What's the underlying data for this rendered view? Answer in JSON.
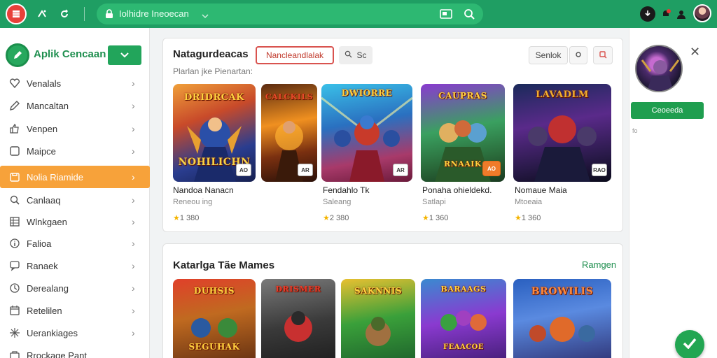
{
  "browser": {
    "url": "Iolhidre Ineoecan"
  },
  "sidebar": {
    "brand": "Aplik Cencaan",
    "items": [
      {
        "label": "Venalals",
        "icon": "heart-icon"
      },
      {
        "label": "Mancaltan",
        "icon": "edit-icon"
      },
      {
        "label": "Venpen",
        "icon": "thumbs-up-icon"
      },
      {
        "label": "Maipce",
        "icon": "window-icon"
      },
      {
        "label": "Nolia Riamide",
        "icon": "folder-icon"
      },
      {
        "label": "Canlaaq",
        "icon": "search-icon"
      },
      {
        "label": "Wlnkgaen",
        "icon": "grid-icon"
      },
      {
        "label": "Falioa",
        "icon": "info-icon"
      },
      {
        "label": "Ranaek",
        "icon": "chat-icon"
      },
      {
        "label": "Derealang",
        "icon": "clock-icon"
      },
      {
        "label": "Retelilen",
        "icon": "calendar-icon"
      },
      {
        "label": "Uerankiages",
        "icon": "star-icon"
      },
      {
        "label": "Rrockage Pant",
        "icon": "bag-icon"
      }
    ],
    "active_index": 4
  },
  "section1": {
    "title": "Natagurdeacas",
    "subtitle": "Plarlan jke Pienartan:",
    "chip_active": "Nancleandlalak",
    "chip_search": "Sc",
    "sort_label": "Senlok",
    "games": [
      {
        "name": "Nandoa Nanacn",
        "dev": "Reneou ing",
        "rating": "1 380",
        "banner_top": "DRIDRCAK",
        "banner_bottom": "NOHILICHN",
        "badge": "AO"
      },
      {
        "name": "",
        "dev": "",
        "rating": "",
        "banner_top": "CALCKILS",
        "banner_bottom": "",
        "badge": "AR"
      },
      {
        "name": "Fendahlo Tk",
        "dev": "Saleang",
        "rating": "2 380",
        "banner_top": "DWIORRE",
        "banner_bottom": "",
        "badge": "AR"
      },
      {
        "name": "Ponaha ohieldekd.",
        "dev": "Satlapi",
        "rating": "1 360",
        "banner_top": "CAUPRAS",
        "banner_bottom": "RNAAIK",
        "badge": "AO"
      },
      {
        "name": "Nomaue Maia",
        "dev": "Mtoeaia",
        "rating": "1 360",
        "banner_top": "LAVADLM",
        "banner_bottom": "",
        "badge": "RAO"
      }
    ]
  },
  "section2": {
    "title": "Katarlga Tãe Mames",
    "link": "Ramgen",
    "games": [
      {
        "banner_top": "DUHSIS",
        "banner_bottom": "SEGUHAK"
      },
      {
        "banner_top": "DRISMER",
        "banner_bottom": ""
      },
      {
        "banner_top": "SAKNNIS",
        "banner_bottom": ""
      },
      {
        "banner_top": "BARAAGS",
        "banner_bottom": "FEAACOE"
      },
      {
        "banner_top": "BROWILIS",
        "banner_bottom": ""
      }
    ]
  },
  "right_panel": {
    "button": "Ceoeeda",
    "small_text": "fo"
  },
  "colors": {
    "brand_green": "#1f9e63",
    "active_orange": "#f7a23a",
    "accent_red": "#d9534f"
  }
}
